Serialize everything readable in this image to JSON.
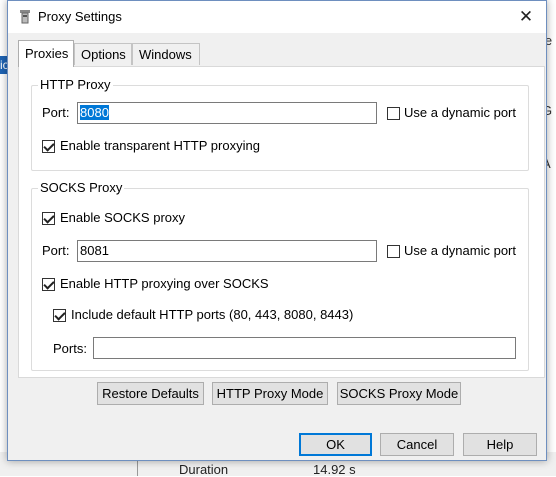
{
  "background": {
    "left_fragment": "ic",
    "right_fragments": [
      "ie",
      "G",
      "A"
    ],
    "status_row": {
      "label": "Duration",
      "value": "14.92 s"
    }
  },
  "dialog": {
    "title": "Proxy Settings",
    "close_glyph": "✕",
    "tabs": [
      {
        "label": "Proxies",
        "active": true
      },
      {
        "label": "Options",
        "active": false
      },
      {
        "label": "Windows",
        "active": false
      }
    ],
    "http_proxy": {
      "title": "HTTP Proxy",
      "port_label": "Port:",
      "port_value": "8080",
      "dynamic_port_label": "Use a dynamic port",
      "dynamic_port_checked": false,
      "transparent_label": "Enable transparent HTTP proxying",
      "transparent_checked": true
    },
    "socks_proxy": {
      "title": "SOCKS Proxy",
      "enable_label": "Enable SOCKS proxy",
      "enable_checked": true,
      "port_label": "Port:",
      "port_value": "8081",
      "dynamic_port_label": "Use a dynamic port",
      "dynamic_port_checked": false,
      "http_over_socks_label": "Enable HTTP proxying over SOCKS",
      "http_over_socks_checked": true,
      "default_ports_label": "Include default HTTP ports (80, 443, 8080, 8443)",
      "default_ports_checked": true,
      "ports_label": "Ports:",
      "ports_value": ""
    },
    "mode_buttons": {
      "restore": "Restore Defaults",
      "http_mode": "HTTP Proxy Mode",
      "socks_mode": "SOCKS Proxy Mode"
    },
    "footer_buttons": {
      "ok": "OK",
      "cancel": "Cancel",
      "help": "Help"
    },
    "colors": {
      "selection": "#0078d7",
      "dialog_bg": "#f0f0f0",
      "panel_bg": "#ffffff"
    }
  }
}
